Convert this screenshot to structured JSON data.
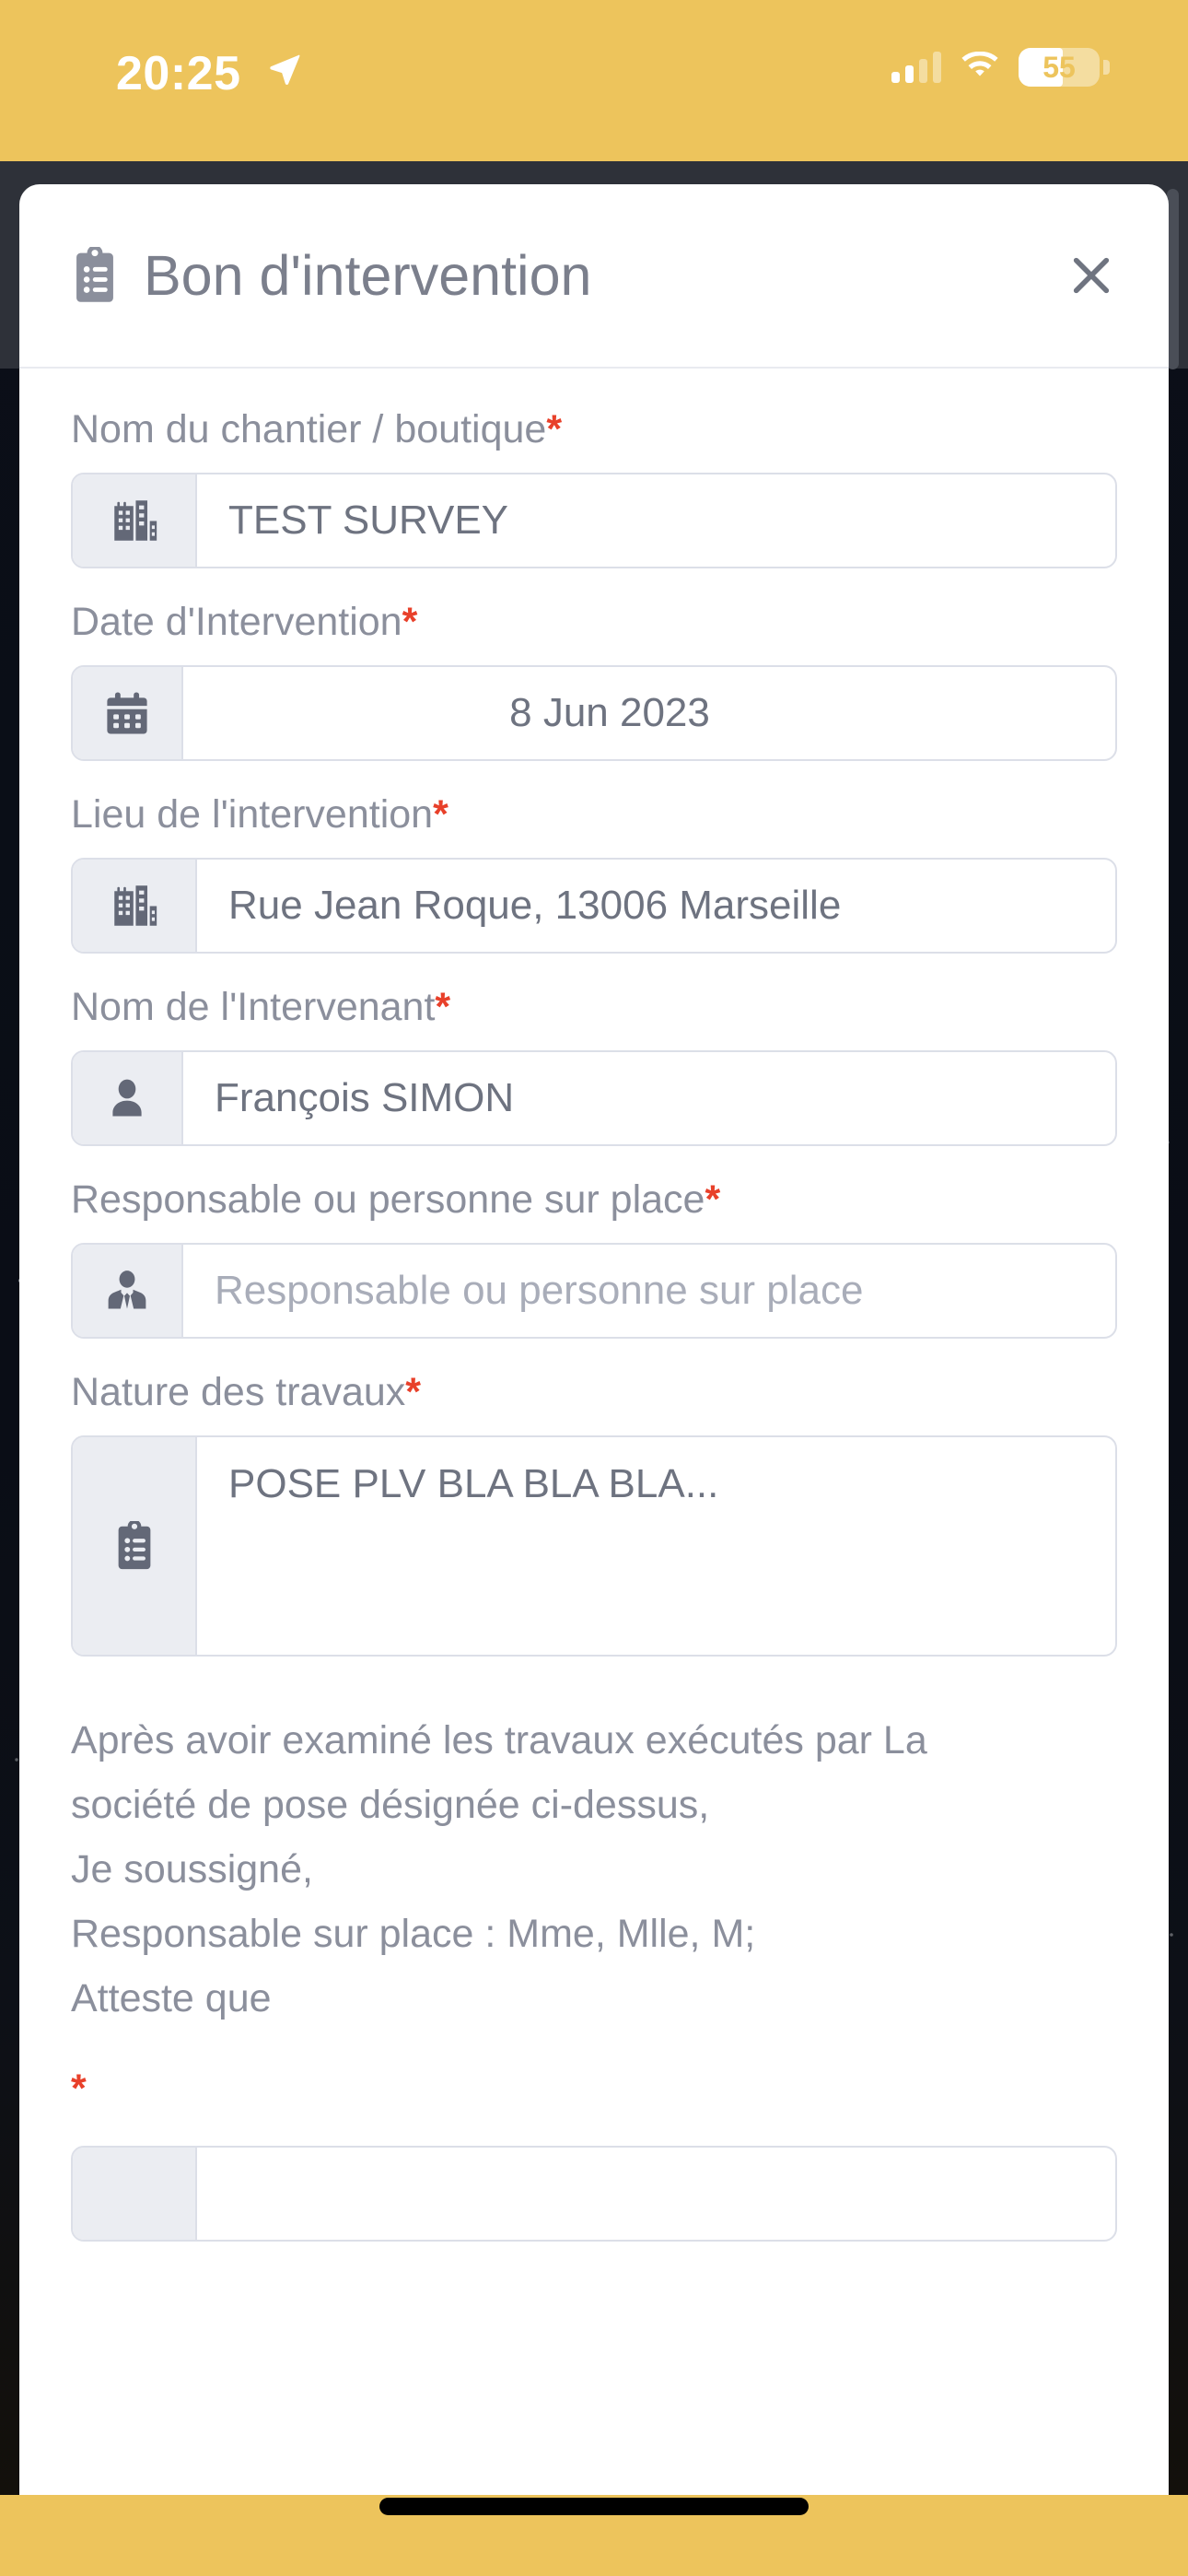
{
  "status_bar": {
    "time": "20:25",
    "location_icon": "location-arrow-icon",
    "signal_icon": "cellular-signal-icon",
    "signal_bars_filled": 2,
    "signal_bars_total": 4,
    "wifi_icon": "wifi-icon",
    "battery_icon": "battery-icon",
    "battery_level": "55",
    "battery_percent": 55,
    "background_color": "#edc45c",
    "text_color": "#ffffff"
  },
  "modal": {
    "icon": "clipboard-list-icon",
    "title": "Bon d'intervention",
    "close_label": "✕"
  },
  "form": {
    "required_marker": "*",
    "fields": [
      {
        "label": "Nom du chantier / boutique",
        "required": true,
        "icon": "building-icon",
        "value": "TEST SURVEY",
        "placeholder": "",
        "align": "left",
        "type": "text"
      },
      {
        "label": "Date d'Intervention",
        "required": true,
        "icon": "calendar-icon",
        "value": "8 Jun 2023",
        "placeholder": "",
        "align": "center",
        "type": "date"
      },
      {
        "label": "Lieu de l'intervention",
        "required": true,
        "icon": "building-icon",
        "value": "Rue Jean Roque, 13006 Marseille",
        "placeholder": "",
        "align": "left",
        "type": "text"
      },
      {
        "label": "Nom de l'Intervenant",
        "required": true,
        "icon": "user-icon",
        "value": "François SIMON",
        "placeholder": "",
        "align": "left",
        "type": "text"
      },
      {
        "label": "Responsable ou personne sur place",
        "required": true,
        "icon": "user-tie-icon",
        "value": "",
        "placeholder": "Responsable ou personne sur place",
        "align": "left",
        "type": "text"
      },
      {
        "label": "Nature des travaux",
        "required": true,
        "icon": "clipboard-list-icon",
        "value": "POSE PLV  BLA BLA BLA...",
        "placeholder": "",
        "align": "left",
        "type": "textarea"
      }
    ]
  },
  "attestation": {
    "lines": [
      "Après avoir examiné les travaux exécutés par La",
      "société de pose désignée ci-dessus,",
      "Je soussigné,",
      "Responsable sur place : Mme, Mlle, M;",
      "Atteste que"
    ],
    "required_marker": "*"
  },
  "colors": {
    "accent_yellow": "#edc45c",
    "chrome_dark": "#2e3139",
    "label_gray": "#8b8f9c",
    "value_gray": "#6e7380",
    "placeholder_gray": "#a9adb9",
    "required_red": "#e8402a",
    "field_border": "#dcdfe8",
    "field_prefix_bg": "#ebedf2"
  }
}
